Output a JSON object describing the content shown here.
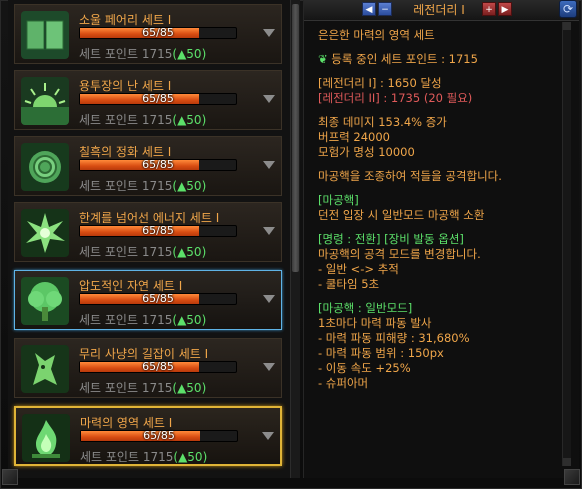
{
  "sets": [
    {
      "name": "소울 페어리 세트 I",
      "icon": "book-icon",
      "progress_text": "65/85",
      "progress": 0.7647,
      "points_label": "세트 포인트",
      "points": "1715",
      "bonus": "(▲50)",
      "state": "normal"
    },
    {
      "name": "용투장의 난 세트 I",
      "icon": "sunrise-icon",
      "progress_text": "65/85",
      "progress": 0.7647,
      "points_label": "세트 포인트",
      "points": "1715",
      "bonus": "(▲50)",
      "state": "normal"
    },
    {
      "name": "칠흑의 정화 세트 I",
      "icon": "rose-icon",
      "progress_text": "65/85",
      "progress": 0.7647,
      "points_label": "세트 포인트",
      "points": "1715",
      "bonus": "(▲50)",
      "state": "normal"
    },
    {
      "name": "한계를 넘어선 에너지 세트 I",
      "icon": "starburst-icon",
      "progress_text": "65/85",
      "progress": 0.7647,
      "points_label": "세트 포인트",
      "points": "1715",
      "bonus": "(▲50)",
      "state": "normal"
    },
    {
      "name": "압도적인 자연 세트 I",
      "icon": "tree-icon",
      "progress_text": "65/85",
      "progress": 0.7647,
      "points_label": "세트 포인트",
      "points": "1715",
      "bonus": "(▲50)",
      "state": "hover"
    },
    {
      "name": "무리 사냥의 길잡이 세트 I",
      "icon": "wolf-icon",
      "progress_text": "65/85",
      "progress": 0.7647,
      "points_label": "세트 포인트",
      "points": "1715",
      "bonus": "(▲50)",
      "state": "normal"
    },
    {
      "name": "마력의 영역 세트 I",
      "icon": "flame-icon",
      "progress_text": "65/85",
      "progress": 0.7647,
      "points_label": "세트 포인트",
      "points": "1715",
      "bonus": "(▲50)",
      "state": "active"
    }
  ],
  "detail": {
    "grade_tab": "레전더리 I",
    "title": "은은한 마력의 영역 세트",
    "registered_label": "등록 중인 세트 포인트 : 1715",
    "legendary1": "[레전더리 I] : 1650 달성",
    "legendary2": "[레전더리 II] : 1735 (20 필요)",
    "stat1": "최종 데미지 153.4% 증가",
    "stat2": "버프력 24000",
    "stat3": "모험가 명성 10000",
    "desc": "마공핵을 조종하여 적들을 공격합니다.",
    "sec1_header": "[마공핵]",
    "sec1_line": "던전 입장 시 일반모드 마공핵 소환",
    "sec2_header": "[명령 : 전환] [장비 발동 옵션]",
    "sec2_line1": "마공핵의 공격 모드를 변경합니다.",
    "sec2_line2": "- 일반 <-> 추적",
    "sec2_line3": "- 쿨타임 5초",
    "sec3_header": "[마공핵 : 일반모드]",
    "sec3_line1": "1초마다 마력 파동 발사",
    "sec3_line2": "- 마력 파동 피해량 : 31,680%",
    "sec3_line3": "- 마력 파동 범위 : 150px",
    "sec3_line4": "- 이동 속도 +25%",
    "sec3_line5": "- 슈퍼아머"
  },
  "colors": {
    "accent": "#f0a64a",
    "bonus": "#5ce06a",
    "active_border": "#e0b437",
    "hover_border": "#5fb3e6",
    "bar_fill": "#d84d12"
  }
}
